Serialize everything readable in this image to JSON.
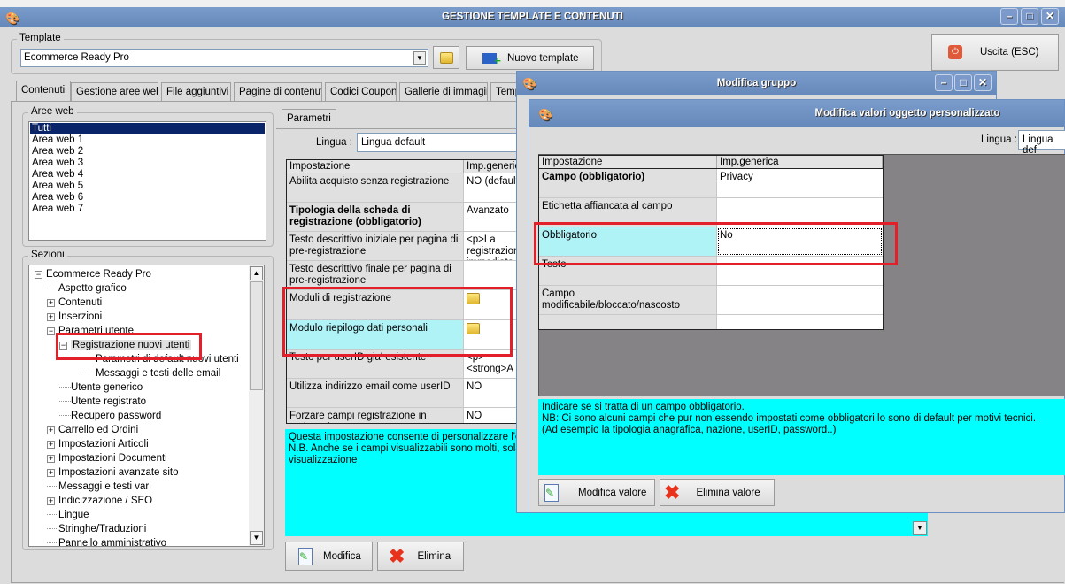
{
  "main_window": {
    "title": "GESTIONE TEMPLATE E CONTENUTI",
    "template_group_label": "Template",
    "template_value": "Ecommerce Ready Pro",
    "new_template_label": "Nuovo template",
    "exit_label": "Uscita (ESC)",
    "tabs": [
      "Contenuti",
      "Gestione aree web",
      "File aggiuntivi",
      "Pagine di contenuti",
      "Codici Coupon",
      "Gallerie di immagini",
      "Temp"
    ],
    "aree_web_label": "Aree web",
    "aree_web": [
      "Tutti",
      "Area web 1",
      "Area web 2",
      "Area web 3",
      "Area web 4",
      "Area web 5",
      "Area web 6",
      "Area web 7"
    ],
    "sezioni_label": "Sezioni",
    "tree": [
      {
        "label": "Ecommerce Ready Pro",
        "level": 0,
        "exp": "-"
      },
      {
        "label": "Aspetto grafico",
        "level": 1,
        "exp": ""
      },
      {
        "label": "Contenuti",
        "level": 1,
        "exp": "+"
      },
      {
        "label": "Inserzioni",
        "level": 1,
        "exp": "+"
      },
      {
        "label": "Parametri utente",
        "level": 1,
        "exp": "-"
      },
      {
        "label": "Registrazione nuovi utenti",
        "level": 2,
        "exp": "-",
        "selected": true
      },
      {
        "label": "Parametri di default nuovi utenti",
        "level": 3,
        "exp": ""
      },
      {
        "label": "Messaggi e testi delle email",
        "level": 3,
        "exp": ""
      },
      {
        "label": "Utente generico",
        "level": 2,
        "exp": ""
      },
      {
        "label": "Utente registrato",
        "level": 2,
        "exp": ""
      },
      {
        "label": "Recupero password",
        "level": 2,
        "exp": ""
      },
      {
        "label": "Carrello ed Ordini",
        "level": 1,
        "exp": "+"
      },
      {
        "label": "Impostazioni Articoli",
        "level": 1,
        "exp": "+"
      },
      {
        "label": "Impostazioni Documenti",
        "level": 1,
        "exp": "+"
      },
      {
        "label": "Impostazioni avanzate sito",
        "level": 1,
        "exp": "+"
      },
      {
        "label": "Messaggi e testi vari",
        "level": 1,
        "exp": ""
      },
      {
        "label": "Indicizzazione / SEO",
        "level": 1,
        "exp": "+"
      },
      {
        "label": "Lingue",
        "level": 1,
        "exp": ""
      },
      {
        "label": "Stringhe/Traduzioni",
        "level": 1,
        "exp": ""
      },
      {
        "label": "Pannello amministrativo",
        "level": 1,
        "exp": ""
      }
    ],
    "params_tab": "Parametri",
    "lingua_label": "Lingua :",
    "lingua_value": "Lingua default",
    "grid_headers": [
      "Impostazione",
      "Imp.generica"
    ],
    "grid_rows": [
      {
        "name": "Abilita acquisto senza registrazione",
        "value": "NO (default)"
      },
      {
        "name": "Tipologia della scheda di\nregistrazione (obbligatorio)",
        "value": "Avanzato",
        "bold": true
      },
      {
        "name": "Testo descrittivo iniziale per pagina di\npre-registrazione",
        "value": "<p>La registrazione\nimmediata e"
      },
      {
        "name": "Testo descrittivo finale per pagina di\npre-registrazione",
        "value": ""
      },
      {
        "name": "Moduli di registrazione",
        "value": "",
        "icon": "folder"
      },
      {
        "name": "Modulo riepilogo dati personali",
        "value": "",
        "icon": "folder",
        "selected": true
      },
      {
        "name": "Testo per userID gia' esistente",
        "value": "  <p>\n  <strong>A"
      },
      {
        "name": "Utilizza indirizzo email come userID",
        "value": "NO"
      },
      {
        "name": "Forzare campi registrazione in maiuscolo",
        "value": "NO"
      }
    ],
    "description": "Questa impostazione consente di personalizzare l'elenco\nN.B. Anche se i campi visualizzabili sono molti, solamente\nvisualizzazione",
    "modify_label": "Modifica",
    "delete_label": "Elimina"
  },
  "group_dialog": {
    "title": "Modifica gruppo"
  },
  "value_dialog": {
    "title": "Modifica valori oggetto personalizzato",
    "lingua_label": "Lingua :",
    "lingua_value": "Lingua def",
    "grid_headers": [
      "Impostazione",
      "Imp.generica"
    ],
    "grid_rows": [
      {
        "name": "Campo (obbligatorio)",
        "value": "Privacy",
        "bold": true
      },
      {
        "name": "Etichetta affiancata al campo",
        "value": ""
      },
      {
        "name": "Obbligatorio",
        "value": "No",
        "selected": true
      },
      {
        "name": "Testo",
        "value": ""
      },
      {
        "name": "Campo modificabile/bloccato/nascosto",
        "value": ""
      },
      {
        "name": "",
        "value": ""
      }
    ],
    "description": "Indicare se si tratta di un campo obbligatorio.\nNB: Ci sono alcuni campi che pur non essendo impostati come obbligatori lo sono di default per motivi tecnici.\n(Ad esempio la tipologia anagrafica, nazione, userID, password..)",
    "modify_label": "Modifica valore",
    "delete_label": "Elimina valore"
  },
  "colors": {
    "titlebar": "#6b8fc0",
    "description_bg": "#00ffff",
    "selected_row": "#aff3f7",
    "highlight": "#e3202a"
  }
}
